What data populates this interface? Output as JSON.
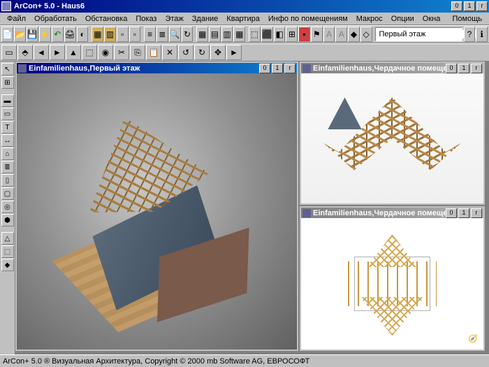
{
  "app": {
    "title": "ArCon+  5.0 - Haus6"
  },
  "menu": {
    "file": "Файл",
    "edit": "Обработать",
    "furnish": "Обстановка",
    "show": "Показ",
    "floor": "Этаж",
    "building": "Здание",
    "apartment": "Квартира",
    "roominfo": "Инфо по помещениям",
    "macros": "Макрос",
    "options": "Опции",
    "windows": "Окна",
    "help": "Помощь"
  },
  "toolbar": {
    "floor_selector": "Первый этаж"
  },
  "windows": {
    "main": {
      "title": "Einfamilienhaus,Первый этаж"
    },
    "roof3d": {
      "title": "Einfamilienhaus,Чердачное помещение"
    },
    "roof2d": {
      "title": "Einfamilienhaus,Чердачное помещение"
    }
  },
  "status": {
    "text": "ArCon+ 5.0 ® Визуальная Архитектура, Copyright © 2000 mb Software AG, ЕВРОСОФТ"
  },
  "winctrl": {
    "min": "0",
    "max": "1",
    "close": "r"
  }
}
